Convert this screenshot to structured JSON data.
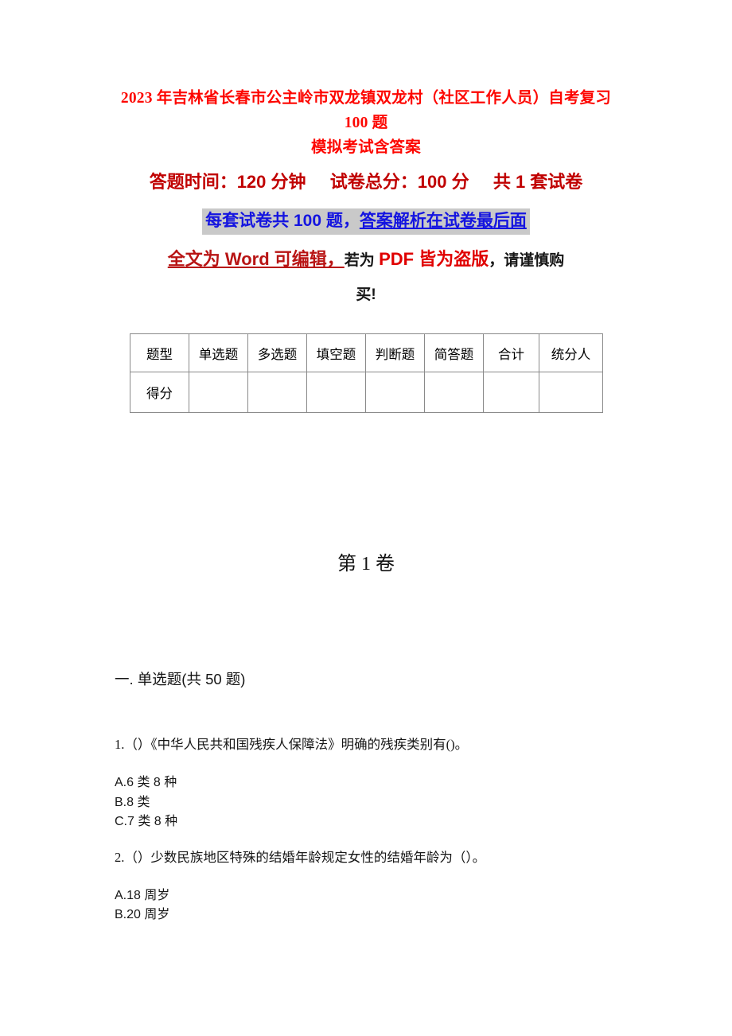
{
  "document": {
    "title_lines": [
      "2023 年吉林省长春市公主岭市双龙镇双龙村（社区工作人员）自考复习 100 题",
      "模拟考试含答案"
    ],
    "title_color": "#fd0600"
  },
  "exam_meta": {
    "duration_label": "答题时间：120 分钟",
    "total_score_label": "试卷总分：100 分",
    "paper_count_label": "共 1 套试卷",
    "meta_color": "#c00000",
    "highlight_line": {
      "plain": "每套试卷共 100 题，",
      "underlined": "答案解析在试卷最后面",
      "text_color": "#1414e0",
      "highlight_color": "#c9c9c9"
    },
    "notice": {
      "segment_word": "全文为 Word 可编辑，",
      "segment_if": "若为 ",
      "segment_pdf": "PDF 皆为盗版",
      "segment_tail": "，请谨慎购",
      "segment_last_line": "买!",
      "word_color": "#b81414",
      "pdf_color": "#e00000"
    }
  },
  "score_table": {
    "headers": [
      "题型",
      "单选题",
      "多选题",
      "填空题",
      "判断题",
      "简答题",
      "合计",
      "统分人"
    ],
    "rows": [
      {
        "label": "得分",
        "cells": [
          "",
          "",
          "",
          "",
          "",
          "",
          ""
        ]
      }
    ]
  },
  "volume": {
    "heading": "第 1 卷"
  },
  "sections": [
    {
      "heading": "一. 单选题(共 50 题)",
      "questions": [
        {
          "stem": "1.（）《中华人民共和国残疾人保障法》明确的残疾类别有()。",
          "options": [
            "A.6 类 8 种",
            "B.8 类",
            "C.7 类 8 种"
          ]
        },
        {
          "stem": "2.（）少数民族地区特殊的结婚年龄规定女性的结婚年龄为（）。",
          "options": [
            "A.18 周岁",
            "B.20 周岁"
          ]
        }
      ]
    }
  ]
}
